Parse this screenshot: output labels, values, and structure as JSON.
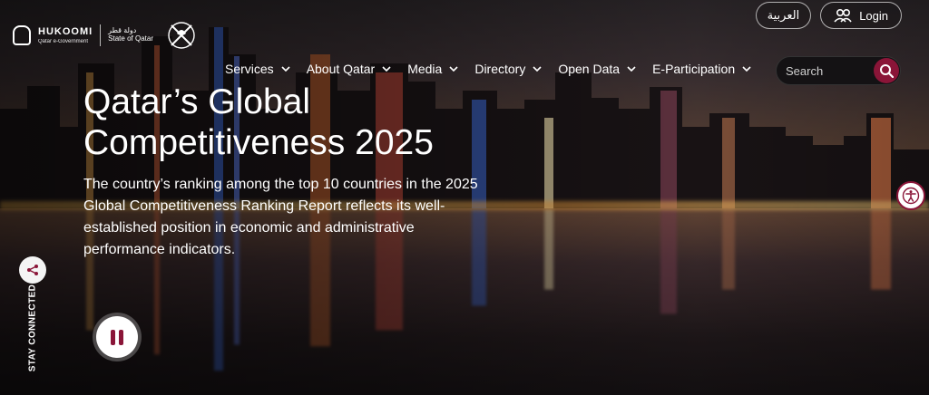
{
  "header": {
    "logo_name": "HUKOOMI",
    "logo_sub": "Qatar e-Government",
    "logo_state_ar": "دولة قطر",
    "logo_state_en": "State of Qatar",
    "language_label": "العربية",
    "login_label": "Login",
    "search_placeholder": "Search"
  },
  "nav": {
    "items": [
      {
        "label": "Services"
      },
      {
        "label": "About Qatar"
      },
      {
        "label": "Media"
      },
      {
        "label": "Directory"
      },
      {
        "label": "Open Data"
      },
      {
        "label": "E-Participation"
      }
    ]
  },
  "hero": {
    "title_line1": "Qatar’s Global",
    "title_line2": "Competitiveness 2025",
    "description": "The country’s ranking among the top 10 countries in the 2025 Global Competitiveness Ranking Report reflects its well-established position in economic and administrative performance indicators."
  },
  "side": {
    "stay_connected": "STAY CONNECTED"
  },
  "icons": {
    "login": "users-icon",
    "search": "search-icon",
    "share": "share-icon",
    "pause": "pause-icon",
    "accessibility": "accessibility-icon"
  },
  "colors": {
    "accent": "#8a1538",
    "search_bg": "#141214"
  }
}
